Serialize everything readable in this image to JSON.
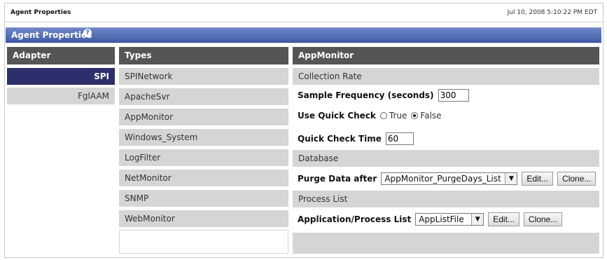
{
  "page": {
    "title": "Agent Properties",
    "timestamp": "Jul 10, 2008 5:10:22 PM EDT"
  },
  "panel": {
    "title": "Agent Properties",
    "help_icon": "help-icon"
  },
  "adapter": {
    "header": "Adapter",
    "items": [
      {
        "label": "SPI",
        "selected": true
      },
      {
        "label": "FglAAM",
        "selected": false
      }
    ]
  },
  "types": {
    "header": "Types",
    "items": [
      {
        "label": "SPINetwork"
      },
      {
        "label": "ApacheSvr"
      },
      {
        "label": "AppMonitor"
      },
      {
        "label": "Windows_System"
      },
      {
        "label": "LogFilter"
      },
      {
        "label": "NetMonitor"
      },
      {
        "label": "SNMP"
      },
      {
        "label": "WebMonitor"
      }
    ]
  },
  "appmonitor": {
    "header": "AppMonitor",
    "sections": {
      "collection_rate": "Collection Rate",
      "database": "Database",
      "process_list": "Process List"
    },
    "fields": {
      "sample_frequency_label": "Sample Frequency (seconds)",
      "sample_frequency_value": "300",
      "use_quick_check_label": "Use Quick Check",
      "radio_true": "True",
      "radio_false": "False",
      "quick_check_time_label": "Quick Check Time",
      "quick_check_time_value": "60",
      "purge_data_label": "Purge Data after",
      "purge_data_value": "AppMonitor_PurgeDays_List",
      "app_process_label": "Application/Process List",
      "app_process_value": "AppListFile"
    },
    "buttons": {
      "edit": "Edit...",
      "clone": "Clone..."
    }
  },
  "colors": {
    "header_dark": "#555555",
    "selected_adapter": "#2d2f6c",
    "section_gray": "#d5d5d5",
    "banner_blue": "#3f5ea9"
  }
}
